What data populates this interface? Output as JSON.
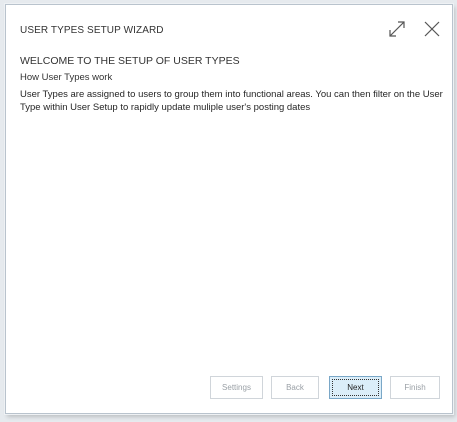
{
  "dialog": {
    "title": "USER TYPES SETUP WIZARD"
  },
  "content": {
    "heading": "WELCOME TO THE SETUP OF USER TYPES",
    "subheading": "How User Types work",
    "description": "User Types are assigned to users to group them into functional areas. You can then filter on the User Type within User Setup to rapidly update muliple user's posting dates"
  },
  "footer": {
    "settings_label": "Settings",
    "back_label": "Back",
    "next_label": "Next",
    "finish_label": "Finish"
  },
  "icons": {
    "expand": "expand-icon",
    "close": "close-icon"
  },
  "colors": {
    "primary_button_bg": "#dbeef9",
    "primary_button_border": "#7aa7c7",
    "disabled_text": "#9aa0a6"
  }
}
